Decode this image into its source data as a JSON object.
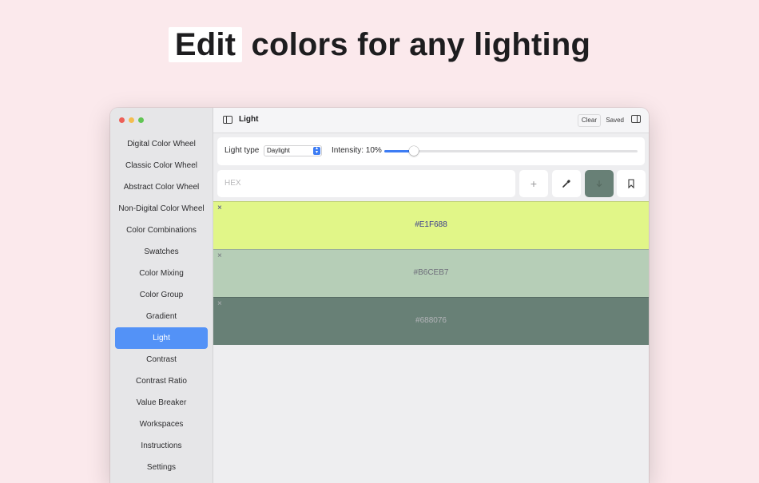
{
  "headline": {
    "highlight": "Edit",
    "rest": " colors for any lighting"
  },
  "window": {
    "title": "Light"
  },
  "toolbar": {
    "clear_label": "Clear",
    "saved_label": "Saved"
  },
  "sidebar": {
    "items": [
      {
        "label": "Digital Color Wheel"
      },
      {
        "label": "Classic Color Wheel"
      },
      {
        "label": "Abstract Color Wheel"
      },
      {
        "label": "Non-Digital Color Wheel"
      },
      {
        "label": "Color Combinations"
      },
      {
        "label": "Swatches"
      },
      {
        "label": "Color Mixing"
      },
      {
        "label": "Color Group"
      },
      {
        "label": "Gradient"
      },
      {
        "label": "Light",
        "active": true
      },
      {
        "label": "Contrast"
      },
      {
        "label": "Contrast Ratio"
      },
      {
        "label": "Value Breaker"
      },
      {
        "label": "Workspaces"
      },
      {
        "label": "Instructions"
      },
      {
        "label": "Settings"
      }
    ]
  },
  "light": {
    "type_label": "Light type",
    "type_value": "Daylight",
    "intensity_label": "Intensity: 10%",
    "intensity": 0.1
  },
  "hex": {
    "placeholder": "HEX"
  },
  "icons": {
    "add": "plus-icon",
    "eyedropper": "eyedropper-icon",
    "download": "arrow-down-icon",
    "bookmark": "bookmark-icon",
    "close": "close-icon",
    "sidebar": "sidebar-toggle-icon",
    "inspector": "inspector-toggle-icon"
  },
  "swatches": [
    {
      "hex": "#E1F688",
      "text_color": "#3a3a8c",
      "close": "×"
    },
    {
      "hex": "#B6CEB7",
      "text_color": "#6e6e7a",
      "close": "×"
    },
    {
      "hex": "#688076",
      "text_color": "#b3b3b8",
      "close": "×"
    }
  ],
  "colors": {
    "accent": "#5392f7",
    "background": "#fbe9ec",
    "slider": "#3d7cf4"
  }
}
